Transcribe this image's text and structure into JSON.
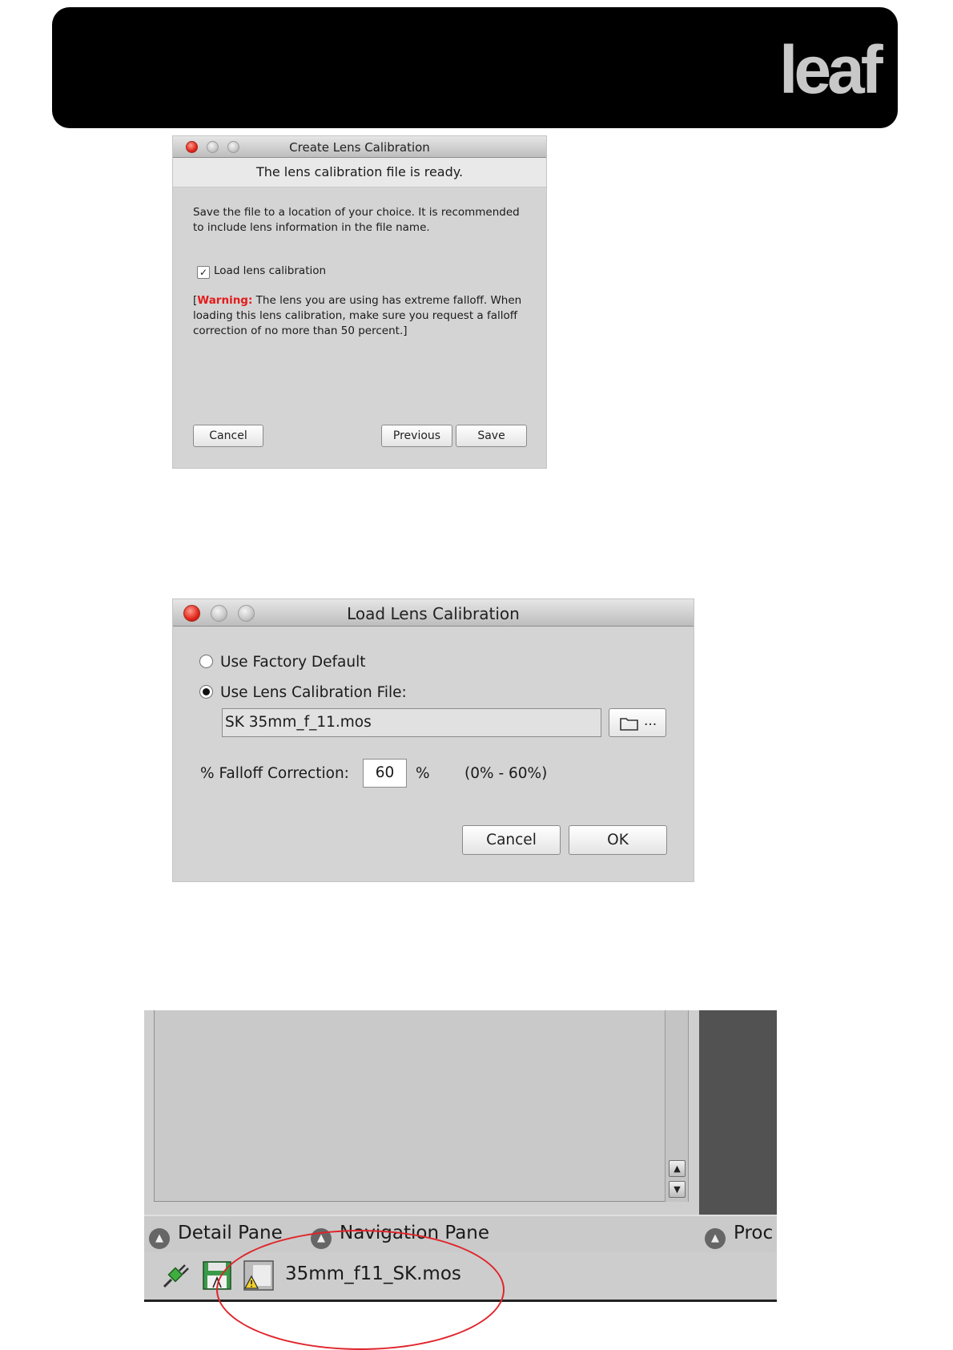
{
  "header": {
    "logo_text": "leaf"
  },
  "create_dialog": {
    "title": "Create Lens Calibration",
    "subtitle": "The lens calibration file is ready.",
    "body": "Save the file to a location of your choice. It is recommended to include lens information in the file name.",
    "checkbox_label": "Load lens calibration",
    "checkbox_checked": true,
    "warning_open": "[",
    "warning_label": "Warning:",
    "warning_text": " The lens you are using has extreme falloff. When loading this lens calibration, make sure you request a falloff correction of no more than 50 percent.]",
    "cancel_label": "Cancel",
    "previous_label": "Previous",
    "save_label": "Save"
  },
  "load_dialog": {
    "title": "Load Lens Calibration",
    "factory_default_label": "Use Factory Default",
    "calibration_file_label": "Use Lens Calibration File:",
    "selected_option": "calibration_file",
    "file_value": "SK 35mm_f_11.mos",
    "browse_label": "...",
    "falloff_label": "% Falloff Correction:",
    "falloff_value": "60",
    "falloff_unit": "%",
    "falloff_range": "(0% - 60%)",
    "cancel_label": "Cancel",
    "ok_label": "OK"
  },
  "app_footer": {
    "detail_pane_label": "Detail Pane",
    "navigation_pane_label": "Navigation Pane",
    "process_pane_label": "Proc",
    "file_name": "35mm_f11_SK.mos"
  },
  "colors": {
    "warning": "#e41a1a",
    "annotation_circle": "#e0242a",
    "banner": "#000000"
  }
}
